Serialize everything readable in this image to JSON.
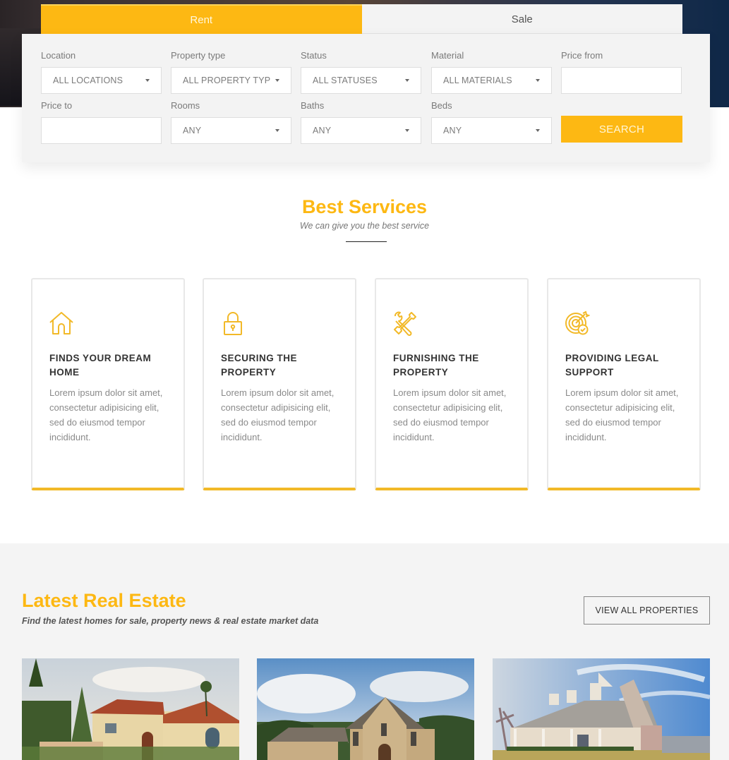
{
  "colors": {
    "accent": "#fdb813",
    "card_border_bottom": "#f2b928",
    "panel_bg": "#f3f3f3",
    "latest_bg": "#f4f4f4"
  },
  "search": {
    "tabs": [
      {
        "label": "Rent",
        "active": true
      },
      {
        "label": "Sale",
        "active": false
      }
    ],
    "fields": {
      "location": {
        "label": "Location",
        "value": "ALL LOCATIONS"
      },
      "property_type": {
        "label": "Property type",
        "value": "ALL PROPERTY TYPES"
      },
      "status": {
        "label": "Status",
        "value": "ALL STATUSES"
      },
      "material": {
        "label": "Material",
        "value": "ALL MATERIALS"
      },
      "price_from": {
        "label": "Price from",
        "value": ""
      },
      "price_to": {
        "label": "Price to",
        "value": ""
      },
      "rooms": {
        "label": "Rooms",
        "value": "ANY"
      },
      "baths": {
        "label": "Baths",
        "value": "ANY"
      },
      "beds": {
        "label": "Beds",
        "value": "ANY"
      }
    },
    "search_button": "SEARCH"
  },
  "services": {
    "title": "Best Services",
    "subtitle": "We can give you the best service",
    "cards": [
      {
        "icon": "house-icon",
        "title": "FINDS YOUR DREAM HOME",
        "text": "Lorem ipsum dolor sit amet, consectetur adipisicing elit, sed do eiusmod tempor incididunt."
      },
      {
        "icon": "padlock-icon",
        "title": "SECURING THE PROPERTY",
        "text": "Lorem ipsum dolor sit amet, consectetur adipisicing elit, sed do eiusmod tempor incididunt."
      },
      {
        "icon": "tools-icon",
        "title": "FURNISHING THE PROPERTY",
        "text": "Lorem ipsum dolor sit amet, consectetur adipisicing elit, sed do eiusmod tempor incididunt."
      },
      {
        "icon": "target-check-icon",
        "title": "PROVIDING LEGAL SUPPORT",
        "text": "Lorem ipsum dolor sit amet, consectetur adipisicing elit, sed do eiusmod tempor incididunt."
      }
    ]
  },
  "latest": {
    "title": "Latest Real Estate",
    "subtitle": "Find the latest homes for sale, property news & real estate market data",
    "view_all_label": "VIEW ALL PROPERTIES",
    "properties": [
      {
        "image": "mediterranean-villa-photo"
      },
      {
        "image": "stone-manor-photo"
      },
      {
        "image": "cape-cod-house-photo"
      }
    ]
  }
}
